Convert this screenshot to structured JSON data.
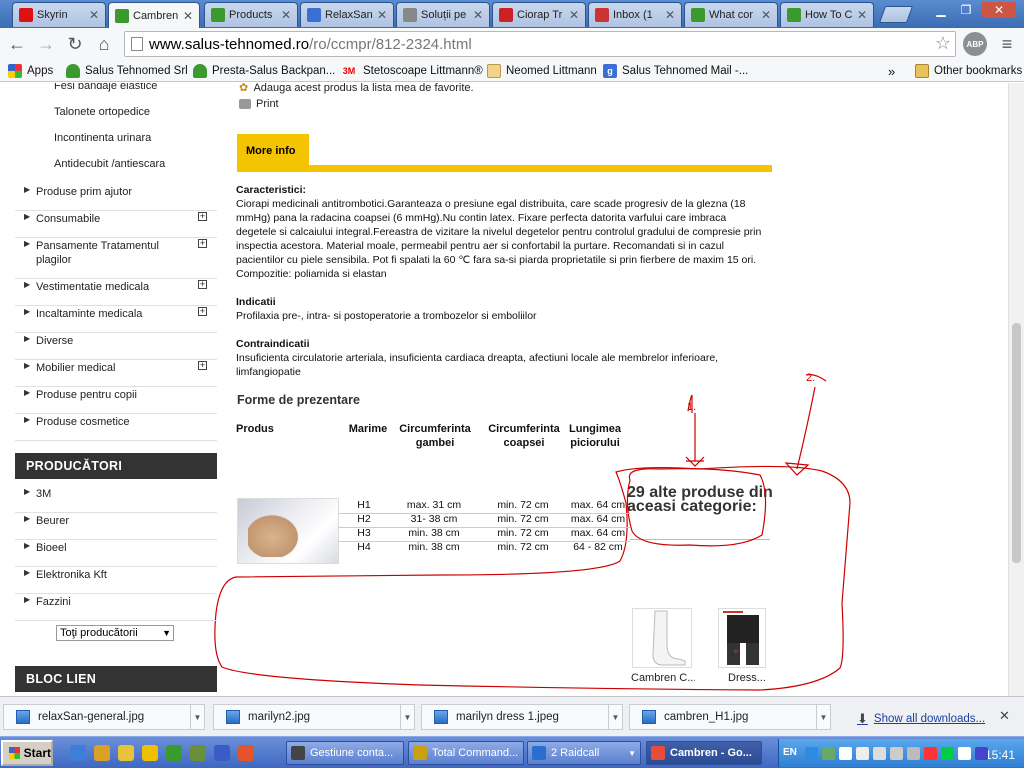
{
  "browser": {
    "tabs": [
      {
        "title": "Skyrin",
        "favicon_color": "#d11"
      },
      {
        "title": "Cambren",
        "favicon_color": "#3a9a2e",
        "active": true
      },
      {
        "title": "Products",
        "favicon_color": "#3a9a2e"
      },
      {
        "title": "RelaxSan",
        "favicon_color": "#3b6fd4"
      },
      {
        "title": "Soluții pe",
        "favicon_color": "#888"
      },
      {
        "title": "Ciorap Tr",
        "favicon_color": "#c22"
      },
      {
        "title": "Inbox (1",
        "favicon_color": "#c33"
      },
      {
        "title": "What cor",
        "favicon_color": "#3a9a2e"
      },
      {
        "title": "How To C",
        "favicon_color": "#3a9a2e"
      }
    ],
    "url_host": "www.salus-tehnomed.ro",
    "url_path": "/ro/ccmpr/812-2324.html",
    "abp_label": "ABP",
    "bookmarks": [
      {
        "label": "Apps",
        "icon": "apps-grid-icon"
      },
      {
        "label": "Salus Tehnomed Srl",
        "icon": "leaf-icon"
      },
      {
        "label": "Presta-Salus Backpan...",
        "icon": "leaf-icon"
      },
      {
        "label": "Stetoscoape Littmann®",
        "icon": "3m-icon",
        "icon_text": "3M"
      },
      {
        "label": "Neomed Littmann",
        "icon": "sign-icon"
      },
      {
        "label": "Salus Tehnomed Mail -...",
        "icon": "google-icon"
      }
    ],
    "bookmarks_overflow": "»",
    "other_bookmarks": "Other bookmarks"
  },
  "sidebar": {
    "sub_items": [
      "Fesi bandaje elastice",
      "Talonete ortopedice",
      "Incontinenta urinara",
      "Antidecubit /antiescara"
    ],
    "categories": [
      {
        "label": "Produse prim ajutor",
        "expandable": false
      },
      {
        "label": "Consumabile",
        "expandable": true
      },
      {
        "label": "Pansamente Tratamentul plagilor",
        "expandable": true
      },
      {
        "label": "Vestimentatie medicala",
        "expandable": true
      },
      {
        "label": "Incaltaminte medicala",
        "expandable": true
      },
      {
        "label": "Diverse",
        "expandable": false
      },
      {
        "label": "Mobilier medical",
        "expandable": true
      },
      {
        "label": "Produse pentru copii",
        "expandable": false
      },
      {
        "label": "Produse cosmetice",
        "expandable": false
      }
    ],
    "producers_heading": "PRODUCĂTORI",
    "producers": [
      "3M",
      "Beurer",
      "Bioeel",
      "Elektronika Kft",
      "Fazzini"
    ],
    "producers_select": "Toţi producătorii",
    "links_heading": "BLOC LIEN"
  },
  "product": {
    "favorites_text": "Adauga acest produs la lista mea de favorite.",
    "print_text": "Print",
    "more_info_tab": "More info",
    "characteristics_title": "Caracteristici:",
    "characteristics_text": "Ciorapi medicinali antitrombotici.Garanteaza o presiune egal distribuita, care scade progresiv de la glezna (18 mmHg) pana la radacina coapsei (6 mmHg).Nu contin latex. Fixare perfecta datorita varfului care imbraca degetele si calcaiului integral.Fereastra de vizitare la nivelul degetelor pentru controlul gradului de compresie prin inspectia acestora. Material moale, permeabil pentru aer si confortabil la purtare. Recomandati si in cazul pacientilor cu piele sensibila. Pot fi spalati la 60 ℃  fara sa-si piarda proprietatile si prin fierbere de maxim 15 ori. Compozitie: poliamida si elastan",
    "indications_title": "Indicatii",
    "indications_text": "Profilaxia pre-, intra- si postoperatorie a trombozelor si emboliilor",
    "contra_title": "Contraindicatii",
    "contra_text": "Insuficienta circulatorie arteriala, insuficienta cardiaca dreapta, afectiuni locale ale membrelor inferioare, limfangiopatie",
    "forms_title": "Forme de prezentare",
    "table_headers": [
      "Produs",
      "Marime",
      "Circumferinta gambei",
      "Circumferinta coapsei",
      "Lungimea piciorului"
    ],
    "table_rows": [
      [
        "H1",
        "max. 31 cm",
        "min. 72 cm",
        "max. 64 cm"
      ],
      [
        "H2",
        "31- 38 cm",
        "min. 72 cm",
        "max. 64 cm"
      ],
      [
        "H3",
        "min. 38 cm",
        "min. 72 cm",
        "max. 64 cm"
      ],
      [
        "H4",
        "min. 38 cm",
        "min. 72 cm",
        "64 - 82 cm"
      ]
    ],
    "other_products_title": "29 alte produse din aceasi categorie:",
    "other_products": [
      "Cambren C...",
      "Dress..."
    ],
    "annotation_marks": [
      "1.",
      "2."
    ]
  },
  "downloads": {
    "items": [
      "relaxSan-general.jpg",
      "marilyn2.jpg",
      "marilyn dress 1.jpeg",
      "cambren_H1.jpg"
    ],
    "show_all": "Show all downloads..."
  },
  "taskbar": {
    "start_label": "Start",
    "tasks": [
      {
        "label": "Gestiune conta...",
        "color": "#444"
      },
      {
        "label": "Total Command...",
        "color": "#c8a010"
      },
      {
        "label": "2 Raidcall",
        "color": "#2a6fd0",
        "dropdown": true
      },
      {
        "label": "Cambren - Go...",
        "color": "#e74c3c",
        "active": true
      }
    ],
    "tray_lang": "EN",
    "clock": "15:41"
  },
  "colors": {
    "accent_yellow": "#f5c400",
    "sidebar_heading_bg": "#333333",
    "annotation_red": "#cc0000",
    "link_blue": "#1a3fa0"
  }
}
